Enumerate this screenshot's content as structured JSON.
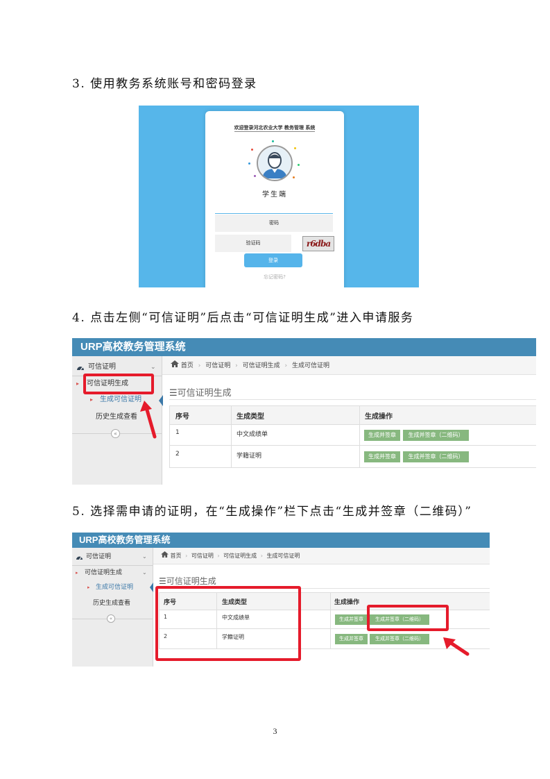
{
  "steps": {
    "step3": "3. 使用教务系统账号和密码登录",
    "step4": "4. 点击左侧“可信证明”后点击“可信证明生成”进入申请服务",
    "step5": "5. 选择需申请的证明，在“生成操作”栏下点击“生成并签章（二维码）”"
  },
  "login": {
    "title": "欢迎登录河北农业大学 教务管理 系统",
    "role": "学生端",
    "username_placeholder": "",
    "password_placeholder": "密码",
    "captcha_placeholder": "验证码",
    "captcha_text": "r6dba",
    "login_button": "登录",
    "forgot_link": "忘记密码?"
  },
  "urp": {
    "app_title": "URP高校教务管理系统",
    "sidebar": {
      "top_menu": "可信证明",
      "submenu": "可信证明生成",
      "active_item": "生成可信证明",
      "history_item": "历史生成查看",
      "collapse_icon": "«"
    },
    "breadcrumb": [
      "首页",
      "可信证明",
      "可信证明生成",
      "生成可信证明"
    ],
    "section_title": "可信证明生成",
    "table": {
      "headers": [
        "序号",
        "生成类型",
        "生成操作"
      ],
      "rows": [
        {
          "index": "1",
          "type": "中文成绩单",
          "btn_sign": "生成并签章",
          "btn_qr": "生成并签章（二维码）"
        },
        {
          "index": "2",
          "type": "学籍证明",
          "btn_sign": "生成并签章",
          "btn_qr": "生成并签章（二维码）"
        }
      ]
    }
  },
  "page_number": "3",
  "colors": {
    "header_blue": "#458bb6",
    "login_bg": "#56b6ea",
    "button_green": "#87b87f",
    "highlight_red": "#e51b2b"
  }
}
